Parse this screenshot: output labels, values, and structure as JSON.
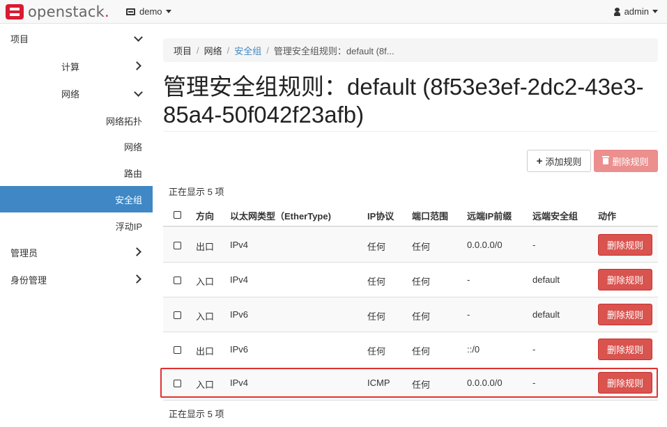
{
  "navbar": {
    "logo_text": "openstack",
    "logo_dot": ".",
    "project": "demo",
    "user": "admin"
  },
  "sidebar": {
    "items": [
      {
        "label": "项目",
        "level": 0,
        "chevron": "down"
      },
      {
        "label": "计算",
        "level": 1,
        "chevron": "right"
      },
      {
        "label": "网络",
        "level": 1,
        "chevron": "down"
      },
      {
        "label": "网络拓扑",
        "level": 2
      },
      {
        "label": "网络",
        "level": 2
      },
      {
        "label": "路由",
        "level": 2
      },
      {
        "label": "安全组",
        "level": 2,
        "active": true
      },
      {
        "label": "浮动IP",
        "level": 2
      },
      {
        "label": "管理员",
        "level": 0,
        "chevron": "right"
      },
      {
        "label": "身份管理",
        "level": 0,
        "chevron": "right"
      }
    ]
  },
  "breadcrumb": {
    "items": [
      "项目",
      "网络",
      "安全组"
    ],
    "current": "管理安全组规则：default (8f..."
  },
  "page": {
    "title": "管理安全组规则：default (8f53e3ef-2dc2-43e3-85a4-50f042f23afb)"
  },
  "actions": {
    "add_rule": "添加规则",
    "delete_rules": "删除规则"
  },
  "table": {
    "count_text_top": "正在显示 5 项",
    "count_text_bottom": "正在显示 5 项",
    "headers": [
      "方向",
      "以太网类型（EtherType)",
      "IP协议",
      "端口范围",
      "远端IP前缀",
      "远端安全组",
      "动作"
    ],
    "rows": [
      {
        "direction": "出口",
        "ethertype": "IPv4",
        "protocol": "任何",
        "port_range": "任何",
        "remote_ip": "0.0.0.0/0",
        "remote_group": "-",
        "action": "删除规则"
      },
      {
        "direction": "入口",
        "ethertype": "IPv4",
        "protocol": "任何",
        "port_range": "任何",
        "remote_ip": "-",
        "remote_group": "default",
        "action": "删除规则"
      },
      {
        "direction": "入口",
        "ethertype": "IPv6",
        "protocol": "任何",
        "port_range": "任何",
        "remote_ip": "-",
        "remote_group": "default",
        "action": "删除规则"
      },
      {
        "direction": "出口",
        "ethertype": "IPv6",
        "protocol": "任何",
        "port_range": "任何",
        "remote_ip": "::/0",
        "remote_group": "-",
        "action": "删除规则"
      },
      {
        "direction": "入口",
        "ethertype": "IPv4",
        "protocol": "ICMP",
        "port_range": "任何",
        "remote_ip": "0.0.0.0/0",
        "remote_group": "-",
        "action": "删除规则"
      }
    ]
  },
  "colors": {
    "accent": "#3f88c5",
    "danger": "#d9534f",
    "highlight": "#e0312f",
    "brand": "#da1a32"
  }
}
